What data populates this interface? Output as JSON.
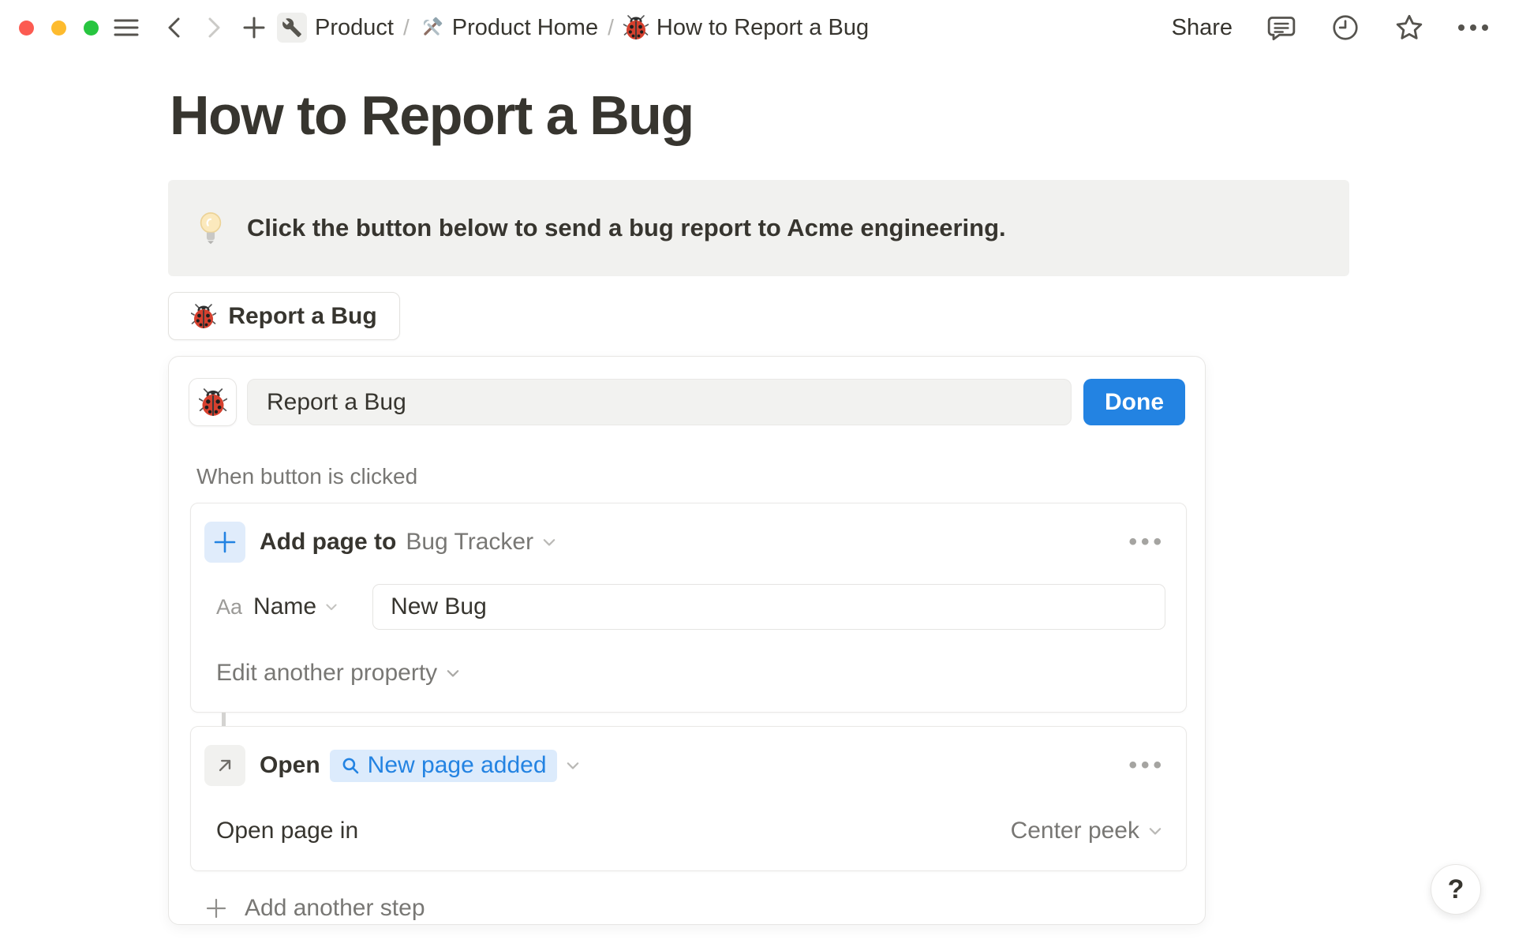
{
  "topbar": {
    "breadcrumb": {
      "separator": "/",
      "items": [
        {
          "label": "Product",
          "icon": "wrench"
        },
        {
          "label": "Product Home",
          "icon": "hammer-and-wrench"
        },
        {
          "label": "How to Report a Bug",
          "icon": "lady-beetle"
        }
      ]
    },
    "share_label": "Share"
  },
  "page": {
    "title": "How to Report a Bug",
    "callout": {
      "icon": "light-bulb",
      "text": "Click the button below to send a bug report to Acme engineering."
    },
    "bug_button": {
      "icon": "lady-beetle",
      "label": "Report a Bug"
    }
  },
  "button_editor": {
    "icon": "lady-beetle",
    "name_input_value": "Report a Bug",
    "done_label": "Done",
    "trigger_label": "When button is clicked",
    "steps": [
      {
        "action_label": "Add page to",
        "target": "Bug Tracker",
        "property_type": "Aa",
        "property_name": "Name",
        "property_value": "New Bug",
        "edit_another_label": "Edit another property"
      },
      {
        "action_label": "Open",
        "target_chip": "New page added",
        "open_page_in_label": "Open page in",
        "open_mode": "Center peek"
      }
    ],
    "add_step_label": "Add another step"
  },
  "help_label": "?",
  "colors": {
    "accent_blue": "#2383e2",
    "chip_bg": "#dcebfc",
    "callout_bg": "#f1f1ef"
  }
}
